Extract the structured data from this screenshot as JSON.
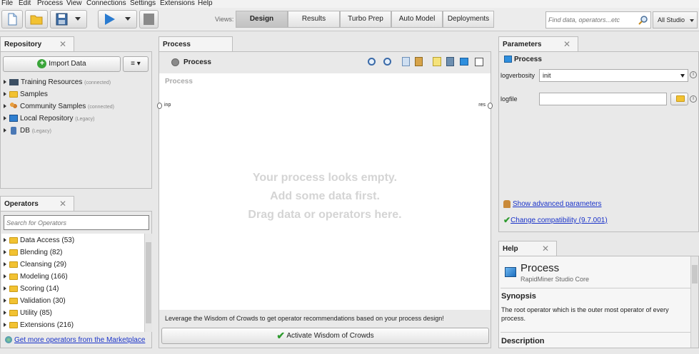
{
  "menu": [
    "File",
    "Edit",
    "Process",
    "View",
    "Connections",
    "Settings",
    "Extensions",
    "Help"
  ],
  "toolbar": {
    "views_label": "Views:",
    "views": [
      "Design",
      "Results",
      "Turbo Prep",
      "Auto Model",
      "Deployments"
    ],
    "search_placeholder": "Find data, operators...etc",
    "studio_select": "All Studio"
  },
  "repository": {
    "title": "Repository",
    "import_label": "Import Data",
    "items": [
      {
        "label": "Training Resources",
        "note": "(connected)",
        "icon": "computer-icon"
      },
      {
        "label": "Samples",
        "note": "",
        "icon": "folder-icon"
      },
      {
        "label": "Community Samples",
        "note": "(connected)",
        "icon": "people-icon"
      },
      {
        "label": "Local Repository",
        "note": "(Legacy)",
        "icon": "monitor-icon"
      },
      {
        "label": "DB",
        "note": "(Legacy)",
        "icon": "database-icon"
      }
    ]
  },
  "operators": {
    "title": "Operators",
    "search_placeholder": "Search for Operators",
    "items": [
      "Data Access (53)",
      "Blending (82)",
      "Cleansing (29)",
      "Modeling (166)",
      "Scoring (14)",
      "Validation (30)",
      "Utility (85)",
      "Extensions (216)"
    ],
    "marketplace_link": "Get more operators from the Marketplace"
  },
  "process": {
    "tab": "Process",
    "header": "Process",
    "canvas_label": "Process",
    "port_in": "inp",
    "port_out": "res",
    "empty": [
      "Your process looks empty.",
      "Add some data first.",
      "Drag data or operators here."
    ],
    "wisdom_text": "Leverage the Wisdom of Crowds to get operator recommendations based on your process design!",
    "wisdom_button": "Activate Wisdom of Crowds"
  },
  "parameters": {
    "title": "Parameters",
    "operator": "Process",
    "logverbosity_label": "logverbosity",
    "logverbosity_value": "init",
    "logfile_label": "logfile",
    "logfile_value": "",
    "advanced_link": "Show advanced parameters",
    "compat_link": "Change compatibility (9.7.001)"
  },
  "help": {
    "title": "Help",
    "op_name": "Process",
    "op_sub": "RapidMiner Studio Core",
    "synopsis_title": "Synopsis",
    "synopsis": "The root operator which is the outer most operator of every process.",
    "description_title": "Description"
  }
}
